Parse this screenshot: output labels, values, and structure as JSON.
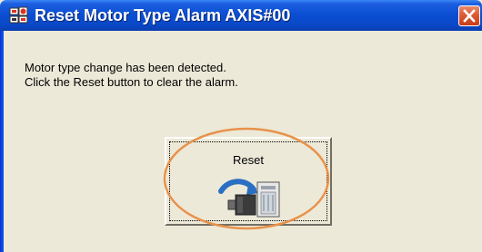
{
  "window": {
    "title": "Reset Motor Type Alarm AXIS#00",
    "icon": "app-icon",
    "close_icon": "close-icon"
  },
  "message": {
    "line1": "Motor type change has been detected.",
    "line2": "Click the Reset button to clear the alarm."
  },
  "reset_button": {
    "label": "Reset",
    "icon": "motor-reset-icon"
  },
  "colors": {
    "titlebar": "#0a48c8",
    "window_face": "#ece9d8",
    "highlight": "#e8924a",
    "close": "#dc5a35"
  }
}
